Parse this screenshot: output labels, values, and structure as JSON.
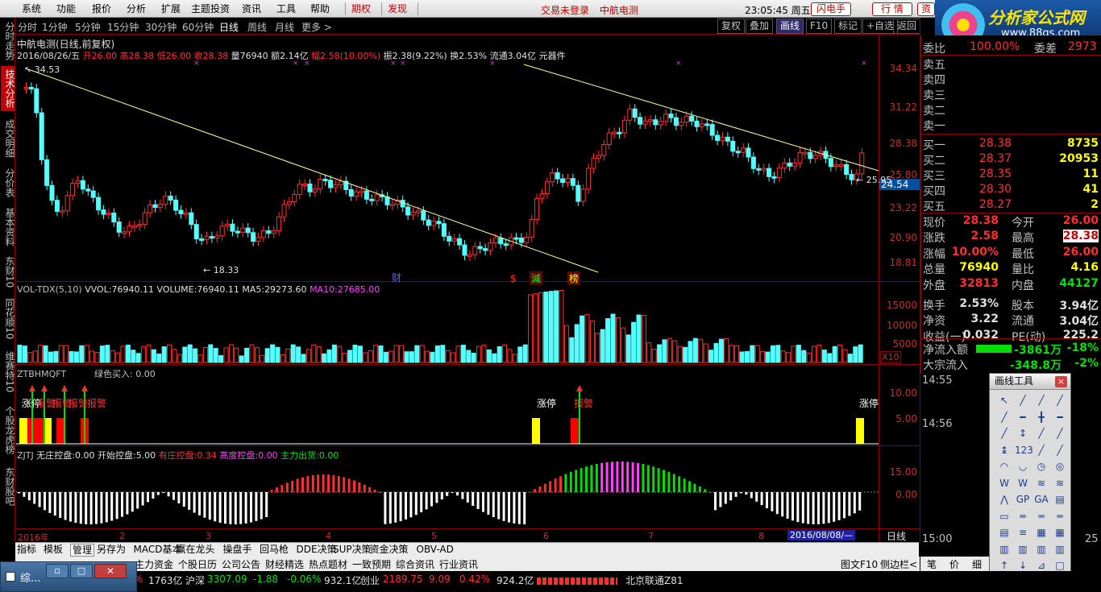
{
  "menu": {
    "items": [
      "系统",
      "功能",
      "报价",
      "分析",
      "扩展",
      "主题投资",
      "资讯",
      "工具",
      "帮助"
    ],
    "red_items": [
      "期权",
      "发现"
    ],
    "login_status": "交易未登录",
    "stock_name": "中航电测",
    "clock": "23:05:45 周五",
    "btn_flash": "闪电手",
    "btn_quote": "行 情",
    "btn_zi": "资"
  },
  "logo": {
    "text": "分析家公式网",
    "url": "www.88gs.com"
  },
  "left_nav": [
    {
      "label": "分时走势",
      "active": false
    },
    {
      "label": "技术分析",
      "active": true
    },
    {
      "label": "成交明细",
      "active": false
    },
    {
      "label": "分价表",
      "active": false
    },
    {
      "label": "基本资料",
      "active": false
    },
    {
      "label": "东财10",
      "active": false
    },
    {
      "label": "同花顺10",
      "active": false
    },
    {
      "label": "维赛特10",
      "active": false
    },
    {
      "label": "个股龙虎榜",
      "active": false
    },
    {
      "label": "东财股吧",
      "active": false
    }
  ],
  "period_bar": {
    "items": [
      "分时",
      "1分钟",
      "5分钟",
      "15分钟",
      "30分钟",
      "60分钟",
      "日线",
      "周线",
      "月线",
      "更多 >"
    ],
    "selected": "日线",
    "right_buttons": [
      "复权",
      "叠加",
      "画线",
      "F10",
      "标记",
      "+自选",
      "返回"
    ],
    "right_selected": "画线"
  },
  "chart_header": {
    "title": "中航电测(日线,前复权)",
    "date": "2016/08/26/五",
    "open_label": "开",
    "open": "26.00",
    "high_label": "高",
    "high": "28.38",
    "low_label": "低",
    "low": "26.00",
    "close_label": "收",
    "close": "28.38",
    "vol_label": "量",
    "vol": "76940",
    "amt_label": "额",
    "amt": "2.14亿",
    "chg_label": "幅",
    "chg": "2.58(10.00%)",
    "amp_label": "振",
    "amp": "2.38(9.22%)",
    "turn_label": "换",
    "turn": "2.53%",
    "float_label": "流通",
    "float": "3.04亿",
    "sector": "元器件"
  },
  "price_axis": [
    "34.34",
    "31.22",
    "28.38",
    "25.80",
    "23.22",
    "20.90",
    "18.81"
  ],
  "price_marks": {
    "max": "34.53",
    "min": "18.33",
    "current": "25.95",
    "cursor": "24.54"
  },
  "event_marks": [
    "财",
    "$",
    "減",
    "榜"
  ],
  "vol_panel": {
    "label": "VOL-TDX(5,10)",
    "vvol_label": "VVOL:",
    "vvol": "76940.11",
    "volume_label": "VOLUME:",
    "volume": "76940.11",
    "ma5_label": "MA5:",
    "ma5": "29273.60",
    "ma10_label": "MA10:",
    "ma10": "27685.00",
    "axis": [
      "15000",
      "10000",
      "5000"
    ],
    "unit": "X10"
  },
  "dragon_panel": {
    "label": "ZTBHMQFT",
    "green_label": "绿色买入:",
    "green_value": "0.00",
    "axis": [
      "10.00",
      "5.00"
    ],
    "marks": [
      "涨停",
      "报警",
      "报警",
      "报警",
      "报警",
      "涨停",
      "报警",
      "涨停"
    ]
  },
  "zjtj_panel": {
    "label": "ZJTJ",
    "items": [
      {
        "k": "无庄控盘:",
        "v": "0.00"
      },
      {
        "k": "开始控盘:",
        "v": "5.00"
      },
      {
        "k": "有庄控盘:",
        "v": "0.34"
      },
      {
        "k": "高度控盘:",
        "v": "0.00"
      },
      {
        "k": "主力出货:",
        "v": "0.00"
      }
    ],
    "axis": [
      "15.00",
      "0.00"
    ]
  },
  "time_axis": {
    "labels": [
      "2016年",
      "2",
      "3",
      "4",
      "5",
      "6",
      "7",
      "8"
    ],
    "cursor_date": "2016/08/08/—",
    "period": "日线"
  },
  "order_book": {
    "weibi_label": "委比",
    "weibi": "100.00%",
    "weicha_label": "委差",
    "weicha": "2973",
    "sells": [
      {
        "label": "卖五"
      },
      {
        "label": "卖四"
      },
      {
        "label": "卖三"
      },
      {
        "label": "卖二"
      },
      {
        "label": "卖一"
      }
    ],
    "buys": [
      {
        "label": "买一",
        "price": "28.38",
        "vol": "8735"
      },
      {
        "label": "买二",
        "price": "28.37",
        "vol": "20953"
      },
      {
        "label": "买三",
        "price": "28.35",
        "vol": "11"
      },
      {
        "label": "买四",
        "price": "28.30",
        "vol": "41"
      },
      {
        "label": "买五",
        "price": "28.27",
        "vol": "2"
      }
    ]
  },
  "quote": [
    {
      "k1": "现价",
      "v1": "28.38",
      "k2": "今开",
      "v2": "26.00"
    },
    {
      "k1": "涨跌",
      "v1": "2.58",
      "k2": "最高",
      "v2": "28.38"
    },
    {
      "k1": "涨幅",
      "v1": "10.00%",
      "k2": "最低",
      "v2": "26.00"
    },
    {
      "k1": "总量",
      "v1": "76940",
      "k2": "量比",
      "v2": "4.16"
    },
    {
      "k1": "外盘",
      "v1": "32813",
      "k2": "内盘",
      "v2": "44127"
    },
    {
      "k1": "换手",
      "v1": "2.53%",
      "k2": "股本",
      "v2": "3.94亿"
    },
    {
      "k1": "净资",
      "v1": "3.22",
      "k2": "流通",
      "v2": "3.04亿"
    },
    {
      "k1": "收益(一)",
      "v1": "0.032",
      "k2": "PE(动)",
      "v2": "225.2"
    }
  ],
  "flows": [
    {
      "k": "净流入额",
      "v": "-3861万",
      "p": "-18%"
    },
    {
      "k": "大宗流入",
      "v": "-348.8万",
      "p": "-2%"
    }
  ],
  "ticks": [
    "14:55",
    "14:56",
    "15:00"
  ],
  "ticks_side": [
    "25"
  ],
  "drawtools": {
    "title": "画线工具",
    "close": "×"
  },
  "bottom_tabs": [
    "指标",
    "模板",
    "管理",
    "另存为",
    "MACD基本",
    "赢在龙头",
    "操盘手",
    "回马枪",
    "DDE决策",
    "SUP决策",
    "资金决策",
    "OBV-AD"
  ],
  "bottom_tabs_selected": "管理",
  "bottom_tabs2": [
    "主力资金",
    "个股日历",
    "公司公告",
    "财经精选",
    "热点题材",
    "一致预期",
    "综合资讯",
    "行业资讯"
  ],
  "bottom_right": [
    "图文F10",
    "侧边栏<"
  ],
  "status": {
    "taskbar_label": "综...",
    "amount1": "1763亿",
    "hs_label": "沪深",
    "hs": "3307.09",
    "hs_chg": "-1.88",
    "hs_pct": "-0.06%",
    "hs_amt": "932.1亿",
    "cy_label": "创业",
    "cy": "2189.75",
    "cy_chg": "9.09",
    "cy_pct": "0.42%",
    "cy_amt": "924.2亿",
    "net": "北京联通Z81",
    "pct_left": "%"
  },
  "side_icons": [
    "笔",
    "价",
    "细"
  ],
  "colors": {
    "up": "#ff3030",
    "down": "#54ffff",
    "trend": "#ffffa0"
  }
}
